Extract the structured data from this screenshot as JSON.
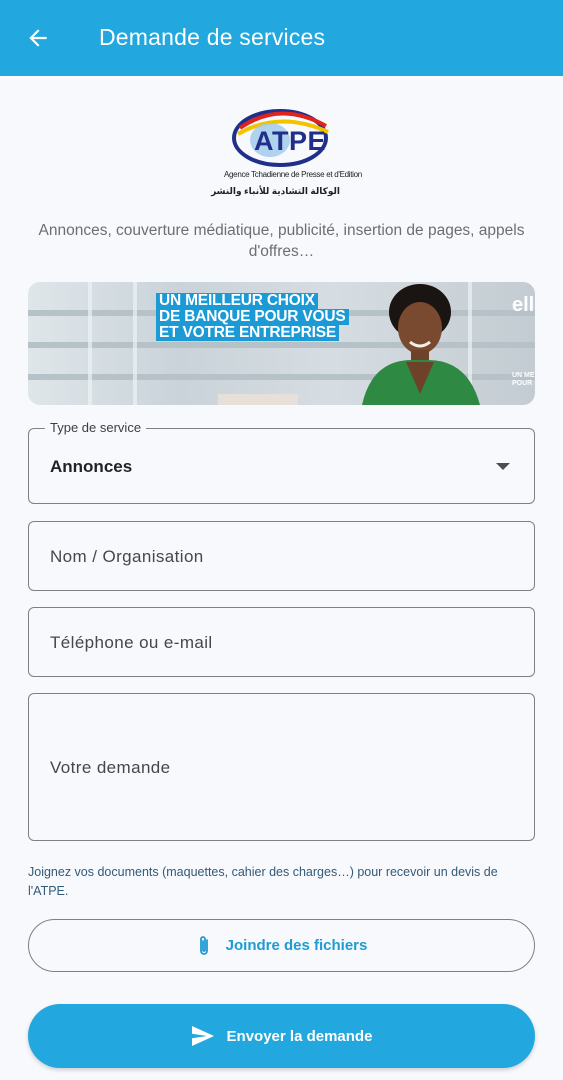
{
  "appbar": {
    "title": "Demande de services",
    "back_icon": "arrow-left-icon",
    "color": "#22a7de"
  },
  "logo": {
    "text": "ATPE",
    "fr_name": "Agence Tchadienne de Presse et d'Edition",
    "ar_name": "الوكالة التشادية للأنباء والنشر"
  },
  "tagline": "Annonces, couverture médiatique, publicité, insertion de pages, appels d'offres…",
  "banner": {
    "lines": [
      "UN MEILLEUR CHOIX",
      "DE BANQUE POUR VOUS",
      "ET VOTRE ENTREPRISE"
    ],
    "brand": "ell",
    "brand_sub": "UN ME POUR"
  },
  "form": {
    "service_type": {
      "label": "Type de service",
      "value": "Annonces",
      "icon": "dropdown-arrow-icon"
    },
    "name": {
      "placeholder": "Nom / Organisation"
    },
    "contact": {
      "placeholder": "Téléphone ou e-mail"
    },
    "request": {
      "placeholder": "Votre demande"
    }
  },
  "hint": "Joignez vos documents (maquettes, cahier des charges…) pour recevoir un devis de l'ATPE.",
  "attach_button": {
    "label": "Joindre des fichiers",
    "icon": "paperclip-icon"
  },
  "send_button": {
    "label": "Envoyer la demande",
    "icon": "send-icon"
  },
  "colors": {
    "accent": "#22a7de",
    "link": "#1f9bd4"
  }
}
